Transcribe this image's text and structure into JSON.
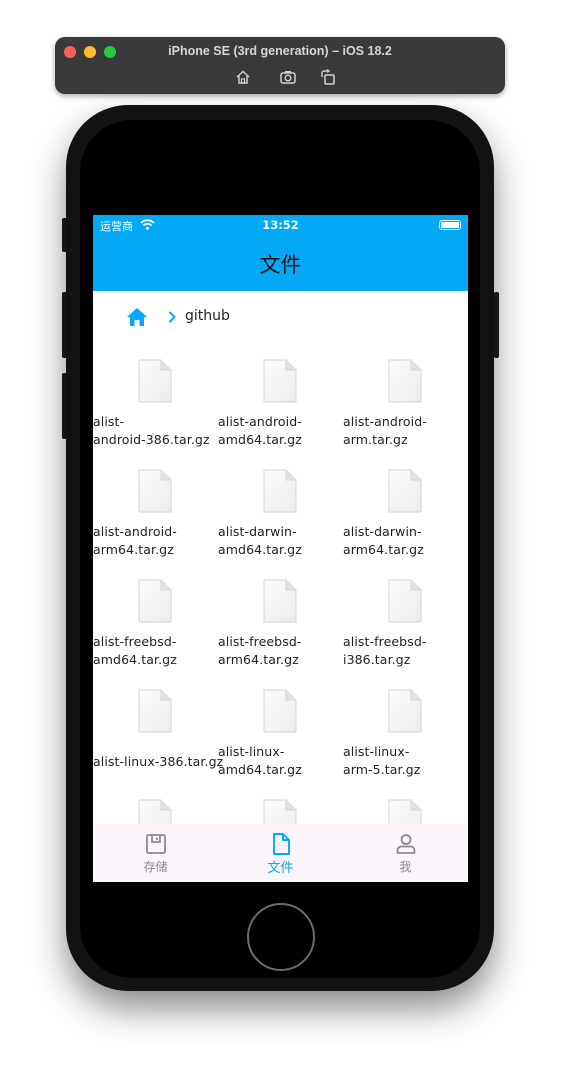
{
  "simulator": {
    "title": "iPhone SE (3rd generation) – iOS 18.2"
  },
  "status_bar": {
    "carrier": "运营商",
    "time": "13:52"
  },
  "app_bar": {
    "title": "文件"
  },
  "breadcrumb": {
    "current": "github"
  },
  "files": [
    {
      "line1": "alist-",
      "line2": "android-386.tar.gz"
    },
    {
      "line1": "alist-android-",
      "line2": "amd64.tar.gz"
    },
    {
      "line1": "alist-android-",
      "line2": "arm.tar.gz"
    },
    {
      "line1": "alist-android-",
      "line2": "arm64.tar.gz"
    },
    {
      "line1": "alist-darwin-",
      "line2": "amd64.tar.gz"
    },
    {
      "line1": "alist-darwin-",
      "line2": "arm64.tar.gz"
    },
    {
      "line1": "alist-freebsd-",
      "line2": "amd64.tar.gz"
    },
    {
      "line1": "alist-freebsd-",
      "line2": "arm64.tar.gz"
    },
    {
      "line1": "alist-freebsd-",
      "line2": "i386.tar.gz"
    },
    {
      "line1": "alist-linux-386.tar.gz",
      "line2": ""
    },
    {
      "line1": "alist-linux-",
      "line2": "amd64.tar.gz"
    },
    {
      "line1": "alist-linux-",
      "line2": "arm-5.tar.gz"
    }
  ],
  "tabs": [
    {
      "label": "存储",
      "icon": "storage-icon",
      "active": false
    },
    {
      "label": "文件",
      "icon": "file-icon",
      "active": true
    },
    {
      "label": "我",
      "icon": "person-icon",
      "active": false
    }
  ],
  "colors": {
    "accent": "#03a9f4",
    "tab_bar_bg": "#fcf5fc",
    "inactive": "#8a8a8a"
  }
}
